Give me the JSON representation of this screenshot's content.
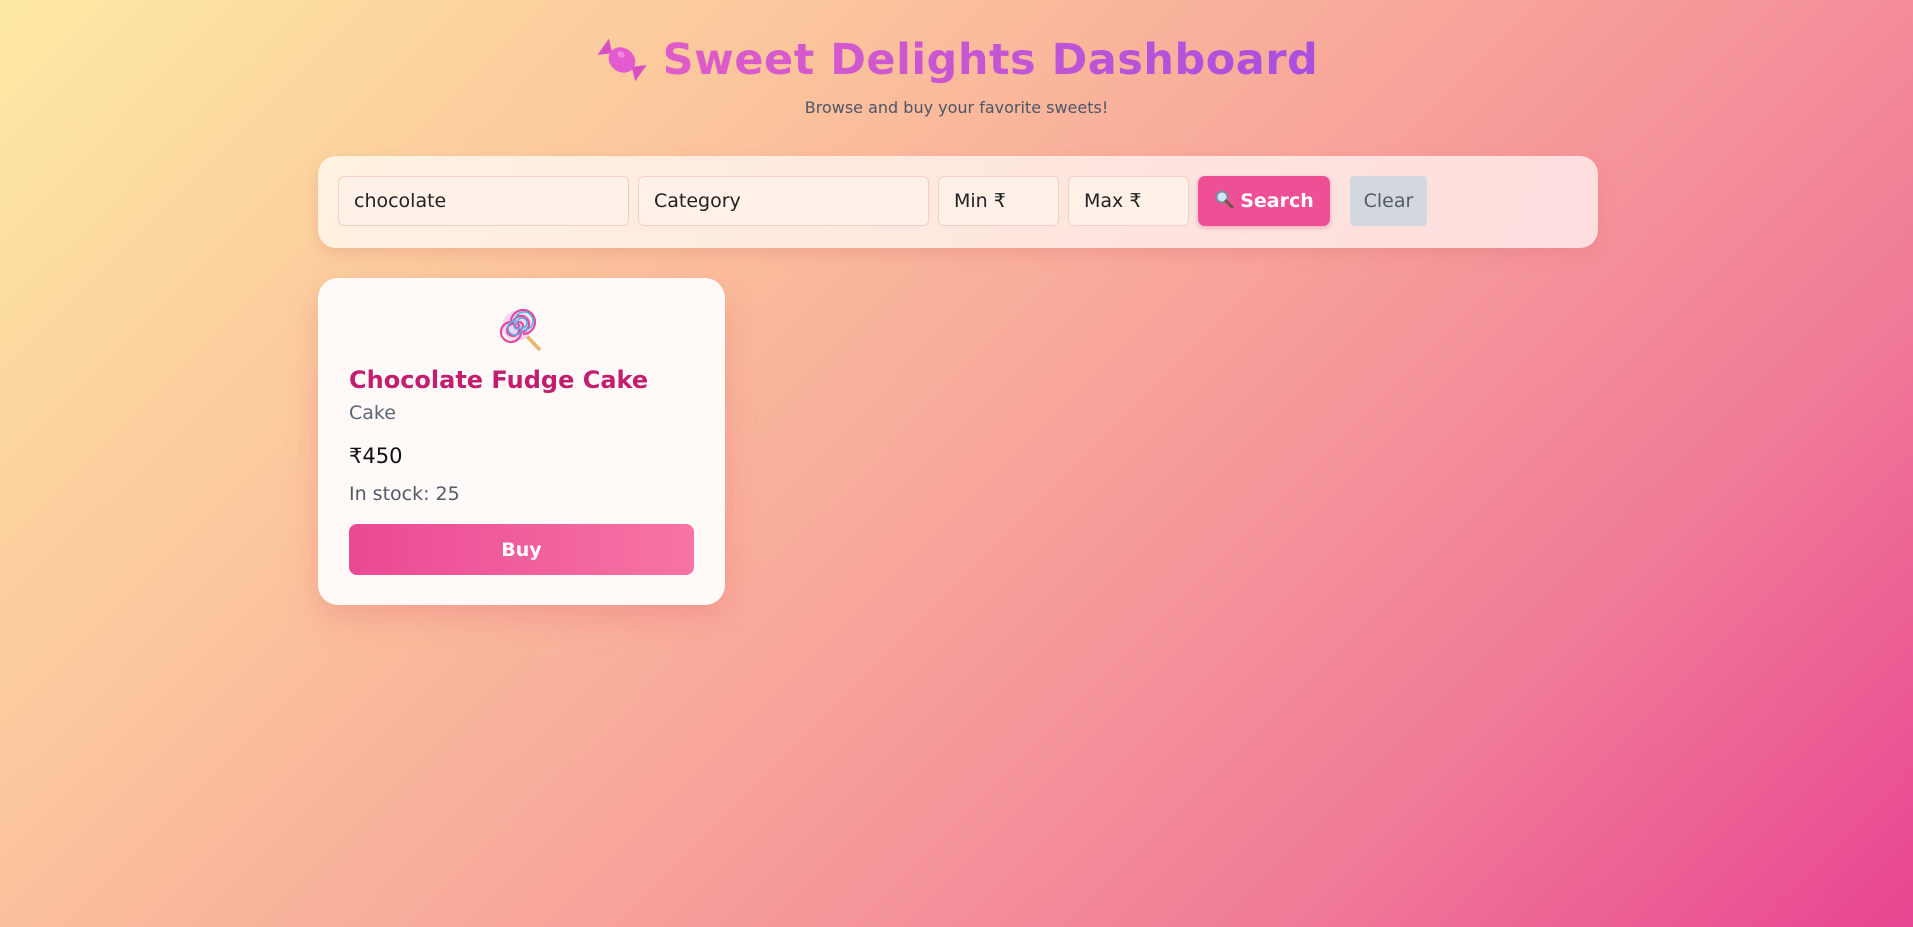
{
  "header": {
    "title": "Sweet Delights Dashboard",
    "subtitle": "Browse and buy your favorite sweets!",
    "icon": "candy-icon"
  },
  "search": {
    "name_value": "chocolate",
    "category_placeholder": "Category",
    "min_placeholder": "Min ₹",
    "max_placeholder": "Max ₹",
    "search_label": "Search",
    "search_icon": "magnifier-icon",
    "clear_label": "Clear"
  },
  "products": [
    {
      "icon": "lollipop-icon",
      "name": "Chocolate Fudge Cake",
      "category": "Cake",
      "price": "₹450",
      "stock": "In stock: 25",
      "buy_label": "Buy"
    }
  ],
  "colors": {
    "title_gradient": [
      "#e05cc8",
      "#a84fe0"
    ],
    "accent": "#ee4f95",
    "product_name": "#c21d6e"
  }
}
